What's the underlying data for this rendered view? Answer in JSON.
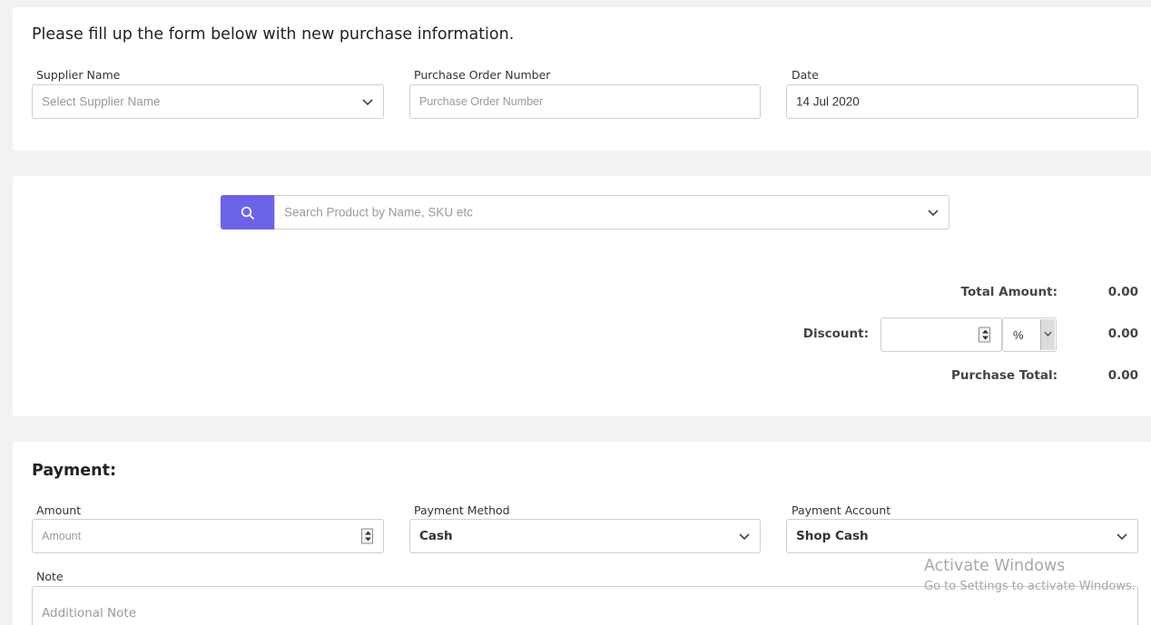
{
  "purchase_form": {
    "heading": "Please fill up the form below with new purchase information.",
    "supplier": {
      "label": "Supplier Name",
      "placeholder": "Select Supplier Name"
    },
    "po_number": {
      "label": "Purchase Order Number",
      "placeholder": "Purchase Order Number"
    },
    "date": {
      "label": "Date",
      "value": "14 Jul 2020"
    }
  },
  "products": {
    "search_placeholder": "Search Product by Name, SKU etc",
    "search_icon": "search-icon"
  },
  "totals": {
    "total_amount_label": "Total Amount:",
    "total_amount_value": "0.00",
    "discount_label": "Discount:",
    "discount_type": "%",
    "discount_value": "0.00",
    "purchase_total_label": "Purchase Total:",
    "purchase_total_value": "0.00"
  },
  "payment": {
    "heading": "Payment:",
    "amount": {
      "label": "Amount",
      "placeholder": "Amount"
    },
    "method": {
      "label": "Payment Method",
      "value": "Cash"
    },
    "account": {
      "label": "Payment Account",
      "value": "Shop Cash"
    },
    "note": {
      "label": "Note",
      "placeholder": "Additional Note"
    }
  },
  "watermark": {
    "line1": "Activate Windows",
    "line2": "Go to Settings to activate Windows."
  },
  "colors": {
    "accent": "#6c63e8",
    "background": "#f2f2f2",
    "card": "#ffffff",
    "border": "#cfcfcf"
  }
}
